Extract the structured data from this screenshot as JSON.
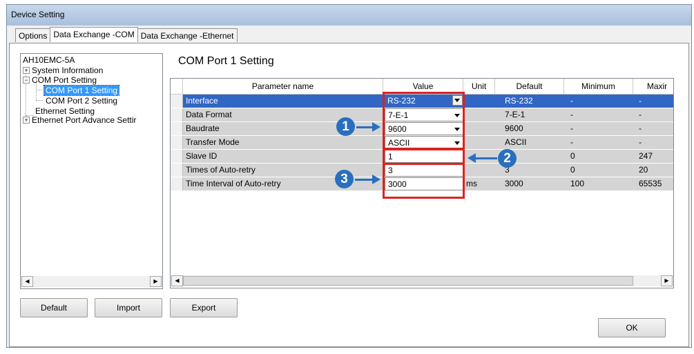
{
  "window": {
    "title": "Device Setting"
  },
  "tabs": [
    {
      "label": "Options"
    },
    {
      "label": "Data Exchange -COM"
    },
    {
      "label": "Data Exchange -Ethernet"
    }
  ],
  "tree": {
    "items": [
      {
        "label": "AH10EMC-5A"
      },
      {
        "label": "System Information",
        "expander": "⊞"
      },
      {
        "label": "COM Port Setting",
        "expander": "⊟"
      },
      {
        "label": "COM Port 1 Setting"
      },
      {
        "label": "COM Port 2 Setting"
      },
      {
        "label": "Ethernet Setting"
      },
      {
        "label": "Ethernet Port Advance Settir",
        "expander": "⊞"
      }
    ]
  },
  "section_title": "COM Port 1 Setting",
  "grid": {
    "columns": [
      "Parameter name",
      "Value",
      "Unit",
      "Default",
      "Minimum",
      "Maxir"
    ],
    "rows": [
      {
        "name": "Interface",
        "value": "RS-232",
        "unit": "",
        "default": "RS-232",
        "min": "-",
        "max": "-"
      },
      {
        "name": "Data Format",
        "value": "7-E-1",
        "unit": "",
        "default": "7-E-1",
        "min": "-",
        "max": "-"
      },
      {
        "name": "Baudrate",
        "value": "9600",
        "unit": "",
        "default": "9600",
        "min": "-",
        "max": "-"
      },
      {
        "name": "Transfer Mode",
        "value": "ASCII",
        "unit": "",
        "default": "ASCII",
        "min": "-",
        "max": "-"
      },
      {
        "name": "Slave ID",
        "value": "1",
        "unit": "",
        "default": "",
        "min": "0",
        "max": "247"
      },
      {
        "name": "Times of Auto-retry",
        "value": "3",
        "unit": "",
        "default": "3",
        "min": "0",
        "max": "20"
      },
      {
        "name": "Time Interval of Auto-retry",
        "value": "3000",
        "unit": "ms",
        "default": "3000",
        "min": "100",
        "max": "65535"
      }
    ]
  },
  "callouts": [
    "1",
    "2",
    "3"
  ],
  "buttons": {
    "default": "Default",
    "import": "Import",
    "export": "Export",
    "ok": "OK"
  },
  "colors": {
    "selection": "#3166c4",
    "row_bg": "#d4d4d4",
    "highlight": "#e02020",
    "callout": "#2a6fbf"
  }
}
